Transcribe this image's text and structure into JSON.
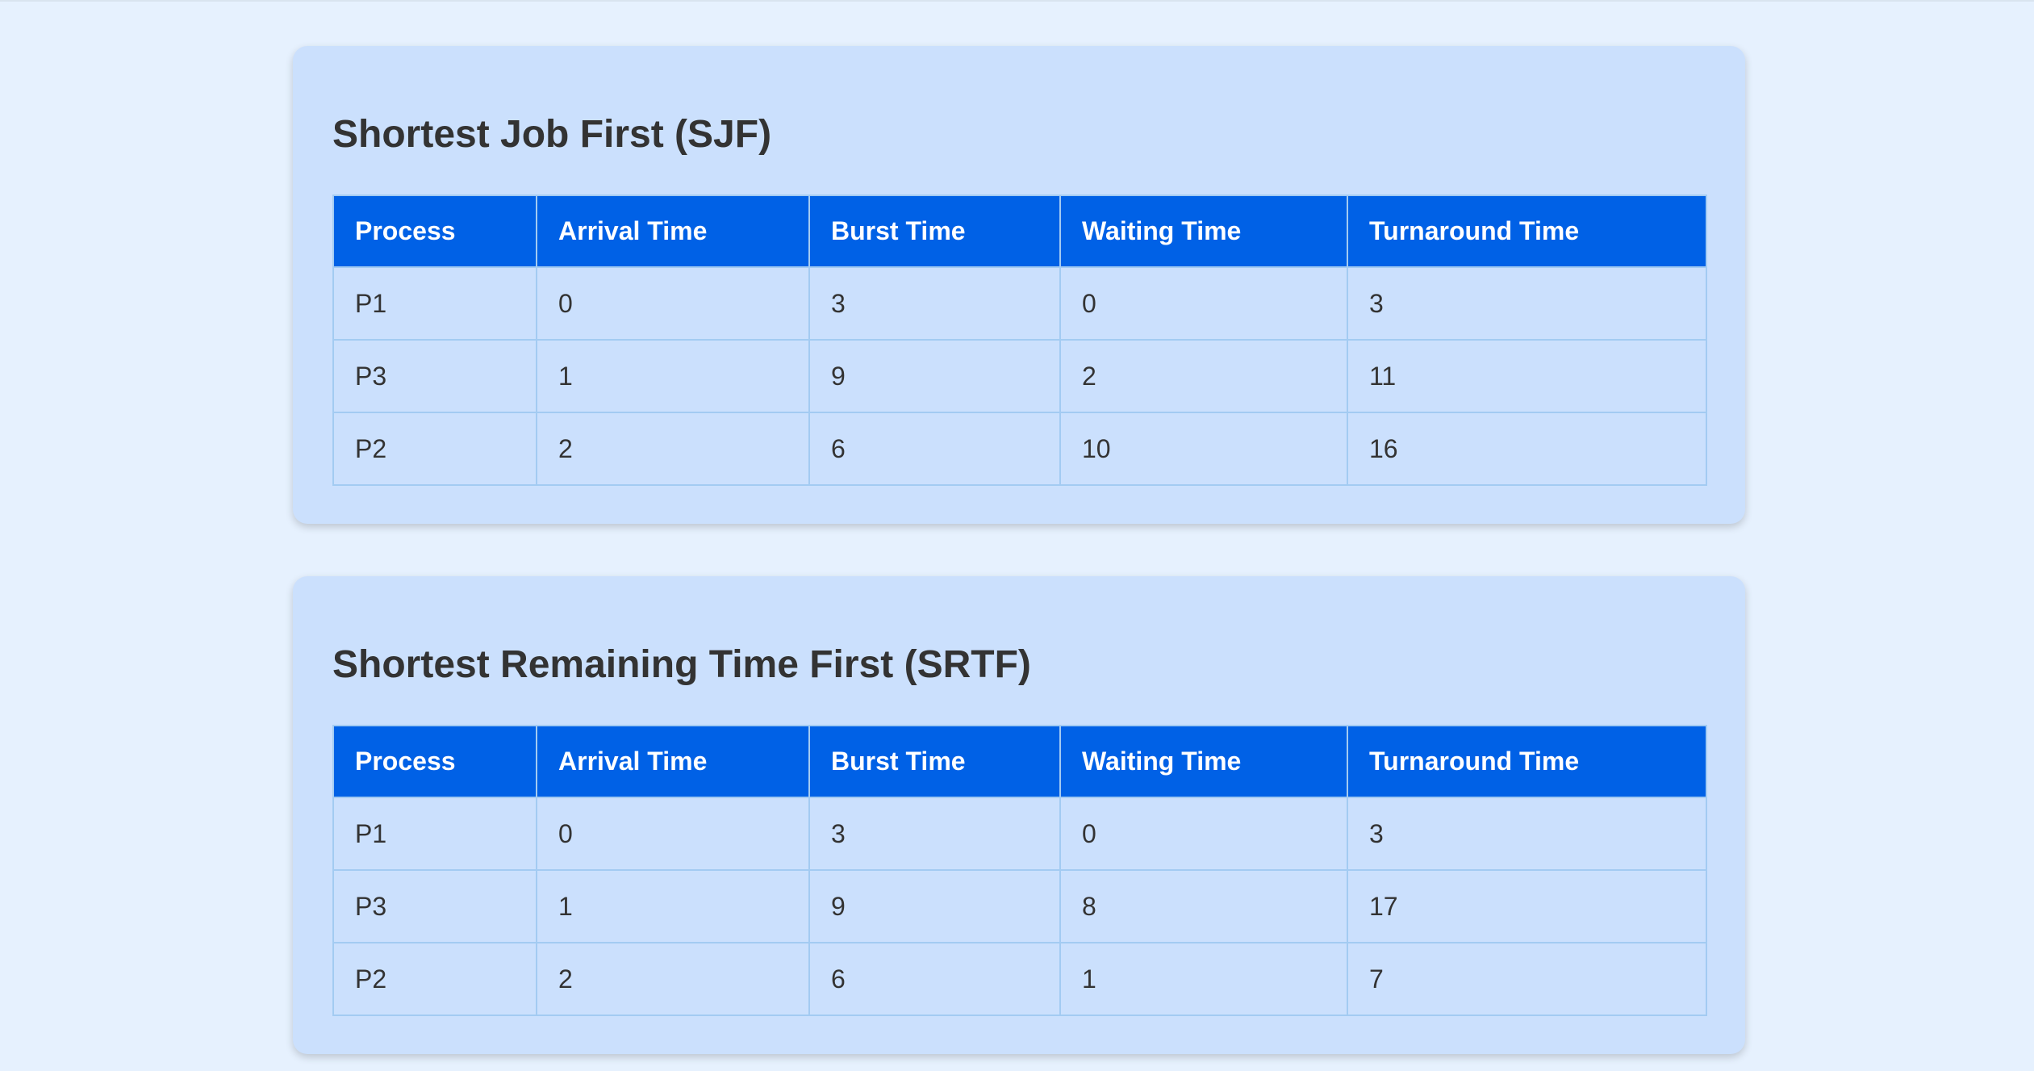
{
  "columns": [
    "Process",
    "Arrival Time",
    "Burst Time",
    "Waiting Time",
    "Turnaround Time"
  ],
  "sections": [
    {
      "title": "Shortest Job First (SJF)",
      "rows": [
        [
          "P1",
          "0",
          "3",
          "0",
          "3"
        ],
        [
          "P3",
          "1",
          "9",
          "2",
          "11"
        ],
        [
          "P2",
          "2",
          "6",
          "10",
          "16"
        ]
      ]
    },
    {
      "title": "Shortest Remaining Time First (SRTF)",
      "rows": [
        [
          "P1",
          "0",
          "3",
          "0",
          "3"
        ],
        [
          "P3",
          "1",
          "9",
          "8",
          "17"
        ],
        [
          "P2",
          "2",
          "6",
          "1",
          "7"
        ]
      ]
    }
  ],
  "colors": {
    "page_background": "#e6f1fe",
    "card_background": "#cbe0fd",
    "header_background": "#0061e6",
    "header_text": "#ffffff",
    "cell_border": "#a3cbf2",
    "body_text": "#333333"
  }
}
